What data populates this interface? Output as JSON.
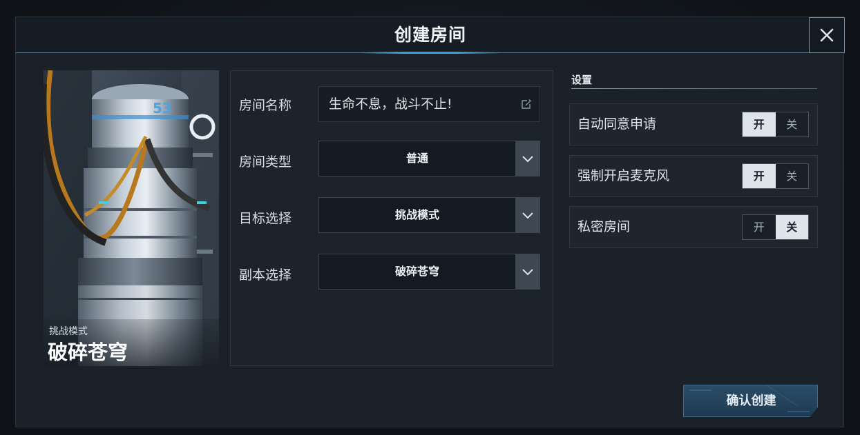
{
  "dialog": {
    "title": "创建房间",
    "close_icon": "close-icon"
  },
  "stage_card": {
    "mode": "挑战模式",
    "name": "破碎苍穹",
    "tower_label": "53"
  },
  "form": {
    "room_name": {
      "label": "房间名称",
      "value": "生命不息，战斗不止!",
      "icon": "edit-icon"
    },
    "room_type": {
      "label": "房间类型",
      "value": "普通",
      "icon": "chevron-down-icon"
    },
    "target": {
      "label": "目标选择",
      "value": "挑战模式",
      "icon": "chevron-down-icon"
    },
    "instance": {
      "label": "副本选择",
      "value": "破碎苍穹",
      "icon": "chevron-down-icon"
    }
  },
  "settings": {
    "title": "设置",
    "items": [
      {
        "label": "自动同意申请",
        "on_label": "开",
        "off_label": "关",
        "state": "on"
      },
      {
        "label": "强制开启麦克风",
        "on_label": "开",
        "off_label": "关",
        "state": "on"
      },
      {
        "label": "私密房间",
        "on_label": "开",
        "off_label": "关",
        "state": "off"
      }
    ]
  },
  "confirm": {
    "label": "确认创建"
  },
  "colors": {
    "accent_blue": "#3a9fd6",
    "toggle_active": "#dde4ea",
    "confirm_bg": "#1e3a52"
  }
}
